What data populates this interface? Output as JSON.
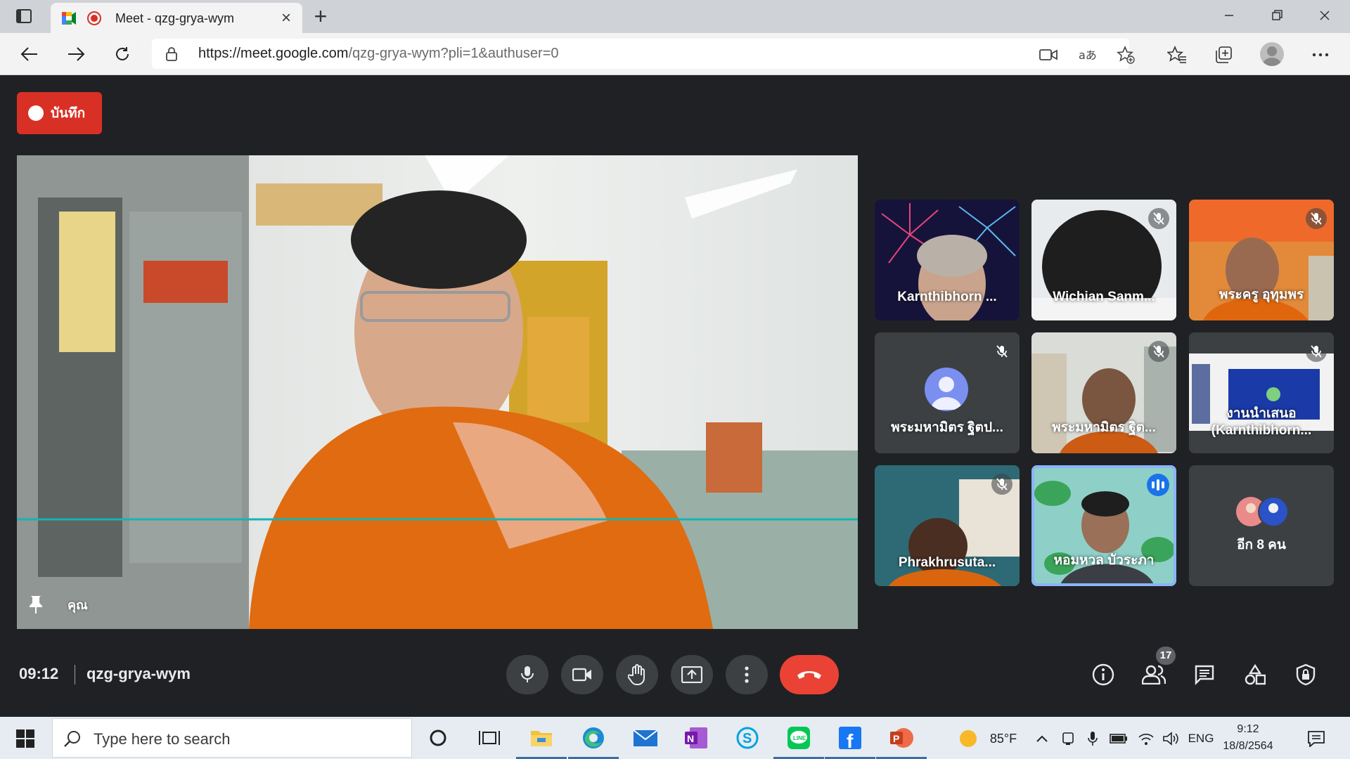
{
  "browser": {
    "tab_title": "Meet - qzg-grya-wym",
    "tab_close": "×",
    "new_tab": "+",
    "url_host": "https://meet.google.com",
    "url_path": "/qzg-grya-wym?pli=1&authuser=0",
    "window_controls": [
      "minimize-icon",
      "restore-icon",
      "close-icon"
    ],
    "toolbar_icons": [
      "back-icon",
      "forward-icon",
      "refresh-icon",
      "camera-icon",
      "read-aloud-icon",
      "add-favorite-icon",
      "favorites-icon",
      "collections-icon",
      "profile-icon",
      "more-icon"
    ]
  },
  "meet": {
    "record_label": "บันทึก",
    "self_name": "คุณ",
    "time": "09:12",
    "meeting_code": "qzg-grya-wym",
    "participant_count": "17",
    "tiles": [
      {
        "name": "Karnthibhorn ...",
        "muted": false
      },
      {
        "name": "Wichian Sanm...",
        "muted": true
      },
      {
        "name": "พระครู อุทุมพร",
        "muted": true
      },
      {
        "name": "พระมหามิตร ฐิตป...",
        "muted": true
      },
      {
        "name": "พระมหามิตร ฐิต...",
        "muted": true
      },
      {
        "name": "งานนำเสนอ (Karnthibhorn...",
        "muted": true
      },
      {
        "name": "Phrakhrusuta...",
        "muted": true
      },
      {
        "name": "หอมหวล บัวระภา",
        "speaking": true
      },
      {
        "name": "อีก 8 คน",
        "muted": false
      }
    ],
    "controls": [
      "mic-icon",
      "camera-icon",
      "raise-hand-icon",
      "present-icon",
      "more-options-icon",
      "hangup-icon"
    ],
    "side_controls": [
      "info-icon",
      "people-icon",
      "chat-icon",
      "activities-icon",
      "host-controls-icon"
    ],
    "colors": {
      "record": "#d93025",
      "hangup": "#ea4335",
      "speaking": "#8ab4f8"
    }
  },
  "taskbar": {
    "search_placeholder": "Type here to search",
    "apps": [
      "cortana-icon",
      "task-view-icon",
      "file-explorer-icon",
      "edge-icon",
      "mail-icon",
      "onenote-icon",
      "skype-icon",
      "line-icon",
      "facebook-icon",
      "powerpoint-icon"
    ],
    "weather": "85°F",
    "language": "ENG",
    "clock_time": "9:12",
    "clock_date": "18/8/2564"
  }
}
